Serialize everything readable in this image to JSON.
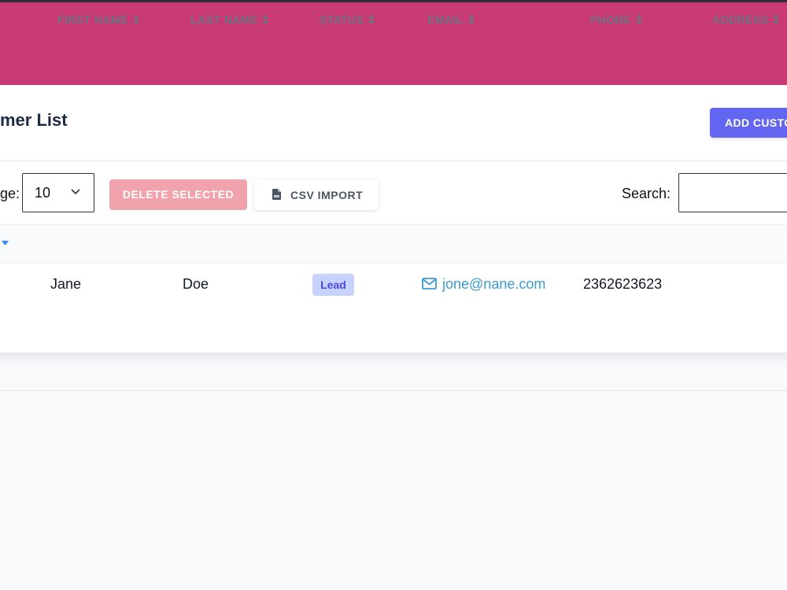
{
  "header": {
    "page_title": "mer List",
    "add_button_label": "ADD CUSTO"
  },
  "toolbar": {
    "per_page_label": "ge:",
    "per_page_value": "10",
    "delete_selected_label": "DELETE SELECTED",
    "csv_import_label": "CSV IMPORT",
    "search_label": "Search:",
    "search_value": ""
  },
  "table": {
    "columns": [
      "FIRST NAME",
      "LAST NAME",
      "STATUS",
      "EMAIL",
      "PHONE",
      "ADDRESS"
    ],
    "rows": [
      {
        "first_name": "Jane",
        "last_name": "Doe",
        "status": "Lead",
        "email": "jone@nane.com",
        "phone": "2362623623",
        "address": ""
      }
    ]
  },
  "colors": {
    "topbar": "#c83a74",
    "primary": "#6366f1",
    "danger_disabled": "#f0a2ad",
    "link": "#3b9bd6",
    "badge_bg": "#c7d2fe",
    "badge_text": "#4f46e5"
  },
  "icons": {
    "per_page_chevron": "chevron-down-icon",
    "csv_import": "file-csv-icon",
    "sort": "sort-icon",
    "email": "envelope-icon"
  }
}
